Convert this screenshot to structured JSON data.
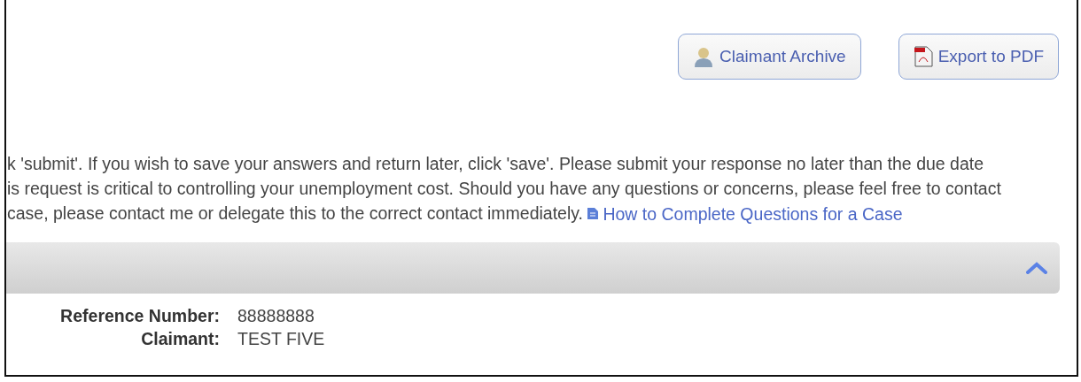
{
  "toolbar": {
    "buttons": [
      {
        "label": "Claimant Archive",
        "kind": "person"
      },
      {
        "label": "Export to PDF",
        "kind": "pdf"
      }
    ]
  },
  "instructions": {
    "lines": [
      "k 'submit'. If you wish to save your answers and return later, click 'save'. Please submit your response no later than the due date",
      "is request is critical to controlling your unemployment cost. Should you have any questions or concerns, please feel free to contact",
      "case, please contact me or delegate this to the correct contact immediately."
    ],
    "link": "How to Complete Questions for a Case"
  },
  "section": {
    "expanded": true,
    "fields": [
      {
        "label": "Reference Number:",
        "value": "88888888"
      },
      {
        "label": "Claimant:",
        "value": "TEST FIVE"
      }
    ]
  }
}
